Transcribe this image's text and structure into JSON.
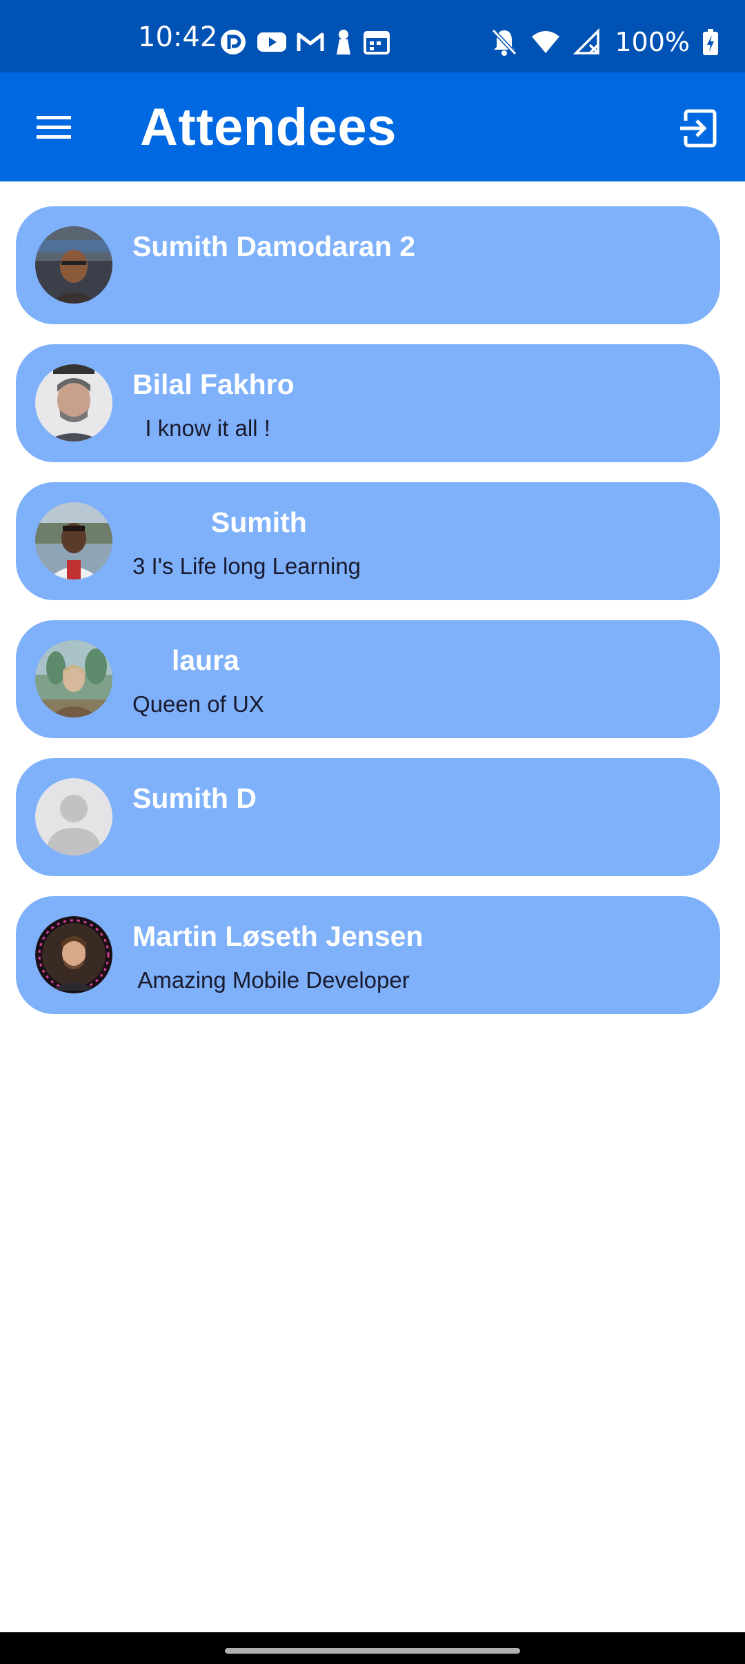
{
  "status_bar": {
    "time": "10:42",
    "battery": "100%",
    "left_icons": [
      "pocket-casts-icon",
      "youtube-icon",
      "gmail-icon",
      "keyhole-icon",
      "calendar-icon"
    ],
    "right_icons": [
      "bell-off-icon",
      "wifi-icon",
      "no-signal-icon",
      "battery-charging-icon"
    ]
  },
  "app_bar": {
    "title": "Attendees",
    "menu_icon": "hamburger-menu-icon",
    "logout_icon": "logout-icon",
    "color": "#0068e0"
  },
  "attendees": [
    {
      "name": "Sumith Damodaran 2",
      "bio": "",
      "avatar": "photo"
    },
    {
      "name": "Bilal Fakhro",
      "bio": "  I know it all !",
      "avatar": "photo"
    },
    {
      "name": "          Sumith",
      "bio": "3 I's Life long Learning",
      "avatar": "photo"
    },
    {
      "name": "     laura",
      "bio": "Queen of UX",
      "avatar": "photo"
    },
    {
      "name": "Sumith D",
      "bio": "",
      "avatar": "placeholder"
    },
    {
      "name": "Martin Løseth Jensen",
      "bio": " Amazing Mobile Developer",
      "avatar": "photo"
    }
  ],
  "colors": {
    "status_bar": "#0052b4",
    "card": "#7fb1fb",
    "name_text": "#ffffff",
    "bio_text": "#1a1a2e"
  }
}
